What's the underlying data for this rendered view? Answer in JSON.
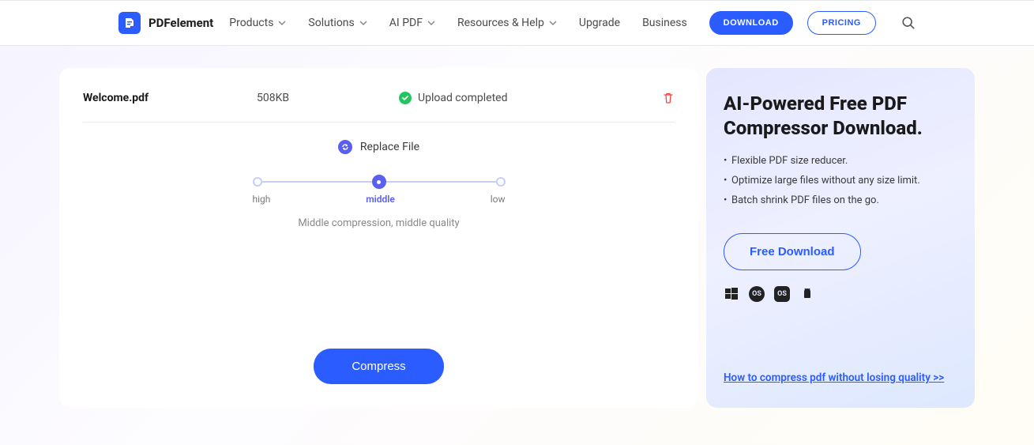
{
  "header": {
    "brand": "PDFelement",
    "nav": {
      "products": "Products",
      "solutions": "Solutions",
      "ai_pdf": "AI PDF",
      "resources": "Resources & Help",
      "upgrade": "Upgrade",
      "business": "Business"
    },
    "download": "DOWNLOAD",
    "pricing": "PRICING"
  },
  "file": {
    "name": "Welcome.pdf",
    "size": "508KB",
    "status": "Upload completed"
  },
  "replace": {
    "label": "Replace File"
  },
  "slider": {
    "high": "high",
    "middle": "middle",
    "low": "low",
    "desc": "Middle compression, middle quality"
  },
  "compress_label": "Compress",
  "promo": {
    "title": "AI-Powered Free PDF Compressor Download.",
    "bullets": [
      "Flexible PDF size reducer.",
      "Optimize large files without any size limit.",
      "Batch shrink PDF files on the go."
    ],
    "free_download": "Free Download",
    "link": "How to compress pdf without losing quality >>"
  }
}
